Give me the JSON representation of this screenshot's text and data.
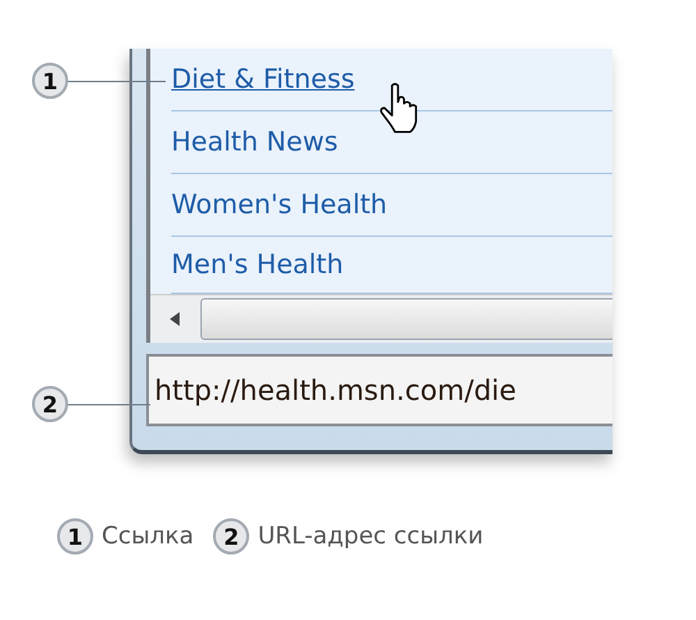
{
  "links": [
    {
      "label": "Diet & Fitness",
      "hovered": true
    },
    {
      "label": "Health News",
      "hovered": false
    },
    {
      "label": "Women's Health",
      "hovered": false
    },
    {
      "label": "Men's Health",
      "hovered": false
    }
  ],
  "status_bar": {
    "url": "http://health.msn.com/die"
  },
  "callouts": [
    {
      "number": "1"
    },
    {
      "number": "2"
    }
  ],
  "legend": [
    {
      "number": "1",
      "label": "Ссылка"
    },
    {
      "number": "2",
      "label": "URL-адрес ссылки"
    }
  ]
}
